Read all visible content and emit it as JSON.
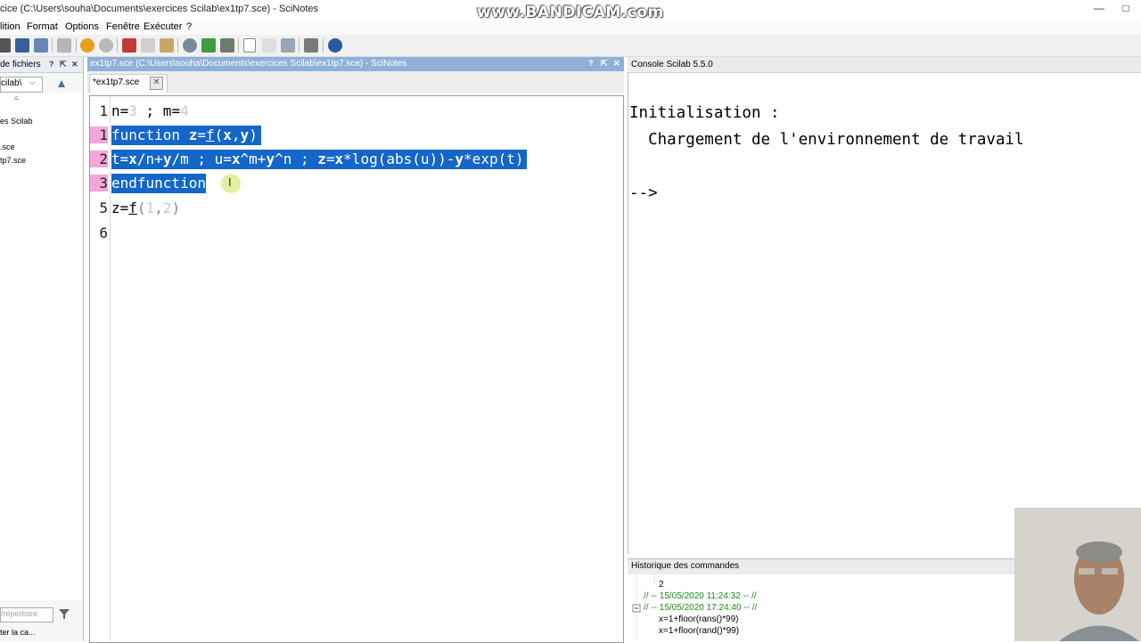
{
  "window": {
    "title": "cice (C:\\Users\\souha\\Documents\\exercices Scilab\\ex1tp7.sce) - SciNotes",
    "watermark": "www.BANDICAM.com",
    "minimize": "—",
    "maximize": "□"
  },
  "menu": {
    "items": [
      "lition",
      "Format",
      "Options",
      "Fenêtre",
      "Exécuter",
      "?"
    ]
  },
  "toolbar": {
    "icons": [
      "new-file-icon",
      "save-icon",
      "save-as-icon",
      "print-icon",
      "undo-icon",
      "redo-icon",
      "cut-icon",
      "copy-icon",
      "paste-icon",
      "find-icon",
      "load-icon",
      "run-icon",
      "execute-icon",
      "execute-file-icon",
      "execute-selection-icon",
      "tools-icon",
      "help-icon"
    ]
  },
  "file_browser": {
    "title": "de fichiers",
    "help": "?",
    "undock": "⇱",
    "close": "✕",
    "dir_value": "cilab\\",
    "tree": [
      "es Scilab",
      ".sce",
      "tp7.sce"
    ],
    "filter_placeholder": "/répertoire",
    "status": "ter la ca..."
  },
  "editor": {
    "header": "ex1tp7.sce (C:\\Users\\souha\\Documents\\exercices Scilab\\ex1tp7.sce) - SciNotes",
    "help": "?",
    "undock": "⇱",
    "close": "✕",
    "tab_label": "*ex1tp7.sce",
    "tab_close": "✕",
    "line_numbers": [
      "1",
      "1",
      "2",
      "3",
      "5",
      "6"
    ],
    "lines": {
      "l1": {
        "a": "n=",
        "b": "3",
        "c": " ; m=",
        "d": "4"
      },
      "l2": {
        "a": "function ",
        "b": "z",
        "c": "=",
        "d": "f",
        "e": "(",
        "f": "x",
        "g": ",",
        "h": "y",
        "i": ")"
      },
      "l3": {
        "a": "t=",
        "b": "x",
        "c": "/n+",
        "d": "y",
        "e": "/m ; u=",
        "f": "x",
        "g": "^m+",
        "h": "y",
        "i": "^n ; ",
        "j": "z",
        "k": "=",
        "l": "x",
        "m": "*log(abs(u))-",
        "n": "y",
        "o": "*exp(t)"
      },
      "l4": {
        "a": "endfunction"
      },
      "l5": {
        "a": "z=",
        "b": "f",
        "c": "(",
        "d": "1",
        "e": ",",
        "f": "2",
        "g": ")"
      }
    }
  },
  "console": {
    "title": "Console Scilab 5.5.0",
    "line1": "Initialisation :",
    "line2": "  Chargement de l'environnement de travail",
    "prompt": "-->"
  },
  "history": {
    "title": "Historique des commandes",
    "items": [
      {
        "text": "2",
        "kind": "cmd"
      },
      {
        "text": "// -- 15/05/2020 11:24:32 -- //",
        "kind": "date"
      },
      {
        "text": "// -- 15/05/2020 17:24:40 -- //",
        "kind": "date"
      },
      {
        "text": "x=1+floor(rans()*99)",
        "kind": "cmd"
      },
      {
        "text": "x=1+floor(rand()*99)",
        "kind": "cmd"
      }
    ]
  },
  "colors": {
    "selection": "#1466c8",
    "line_highlight": "#f4a6d8",
    "editor_header": "#8fb1d8",
    "history_date": "#1a8a1a"
  }
}
